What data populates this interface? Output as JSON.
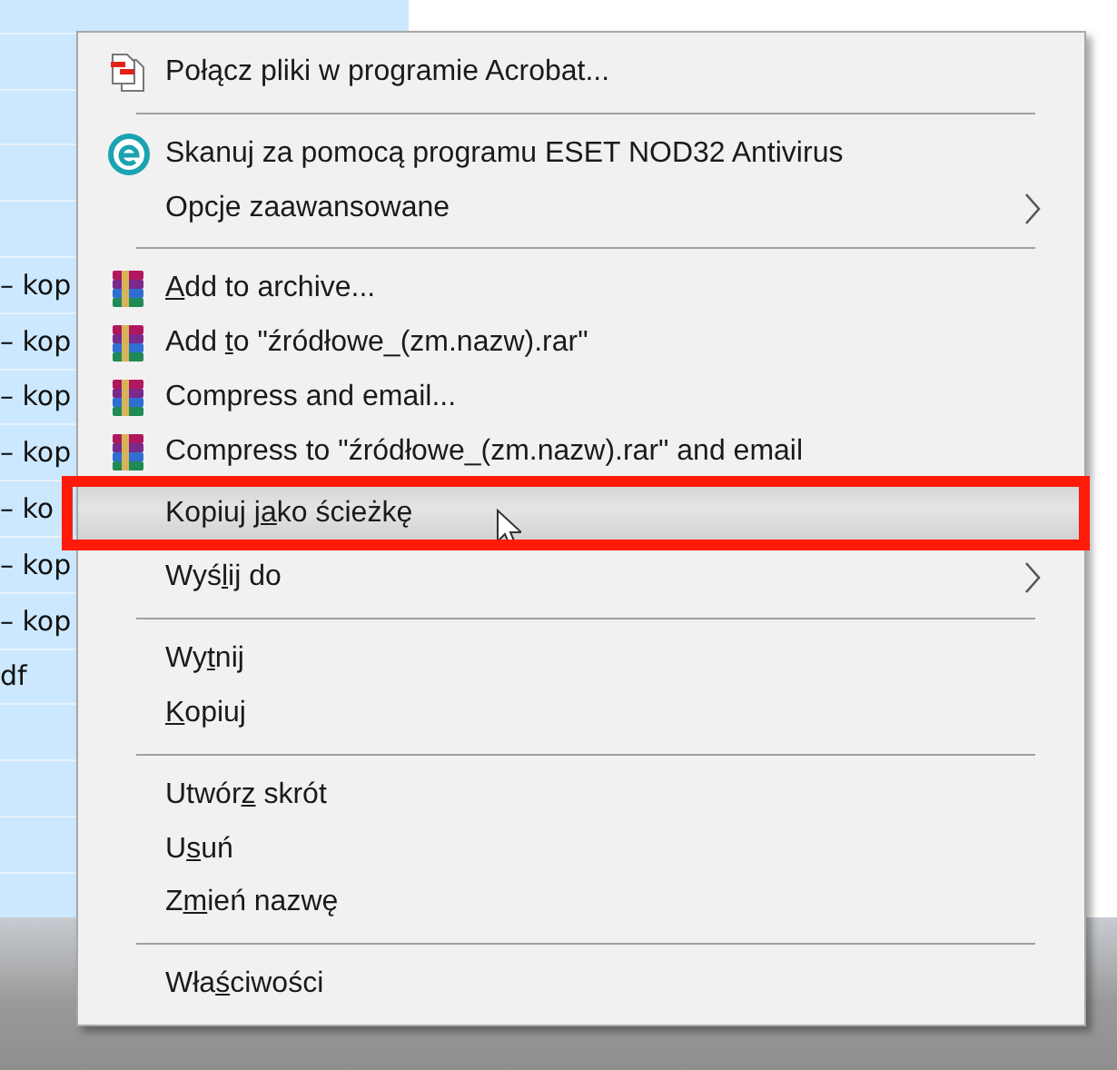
{
  "file_list": {
    "rows": [
      {},
      {},
      {},
      {},
      {},
      {
        "text": "– kop"
      },
      {
        "text": "– kop"
      },
      {
        "text": "– kop"
      },
      {
        "text": "– kop"
      },
      {
        "text": "– ko"
      },
      {
        "text": "– kop"
      },
      {
        "text": "– kop"
      },
      {
        "text": "df"
      },
      {},
      {},
      {},
      {}
    ]
  },
  "context_menu": {
    "items": [
      {
        "kind": "documents",
        "label": [
          {
            "text": "Połącz pliki w programie Acrobat...",
            "underlined": false
          }
        ],
        "submenu": false,
        "selected": false
      },
      {
        "kind": "separator"
      },
      {
        "kind": "antivirus",
        "label": [
          {
            "text": "Skanuj za pomocą programu ESET NOD32 Antivirus",
            "underlined": false
          }
        ],
        "submenu": false,
        "selected": false
      },
      {
        "kind": "plain",
        "label": [
          {
            "text": "Opcje zaawansowane",
            "underlined": false
          }
        ],
        "submenu": true,
        "selected": false
      },
      {
        "kind": "separator"
      },
      {
        "kind": "archive",
        "label": [
          {
            "text": "A",
            "underlined": true
          },
          {
            "text": "dd to archive...",
            "underlined": false
          }
        ],
        "submenu": false,
        "selected": false
      },
      {
        "kind": "archive",
        "label": [
          {
            "text": "Add ",
            "underlined": false
          },
          {
            "text": "t",
            "underlined": true
          },
          {
            "text": "o \"źródłowe_(zm.nazw).rar\"",
            "underlined": false
          }
        ],
        "submenu": false,
        "selected": false
      },
      {
        "kind": "archive",
        "label": [
          {
            "text": "Compress and email...",
            "underlined": false
          }
        ],
        "submenu": false,
        "selected": false
      },
      {
        "kind": "archive",
        "label": [
          {
            "text": "Compress to \"źródłowe_(zm.nazw).rar\" and email",
            "underlined": false
          }
        ],
        "submenu": false,
        "selected": false
      },
      {
        "kind": "plain",
        "label": [
          {
            "text": "Kopiuj j",
            "underlined": false
          },
          {
            "text": "a",
            "underlined": true
          },
          {
            "text": "ko ścieżkę",
            "underlined": false
          }
        ],
        "submenu": false,
        "selected": true,
        "annotated": true
      },
      {
        "kind": "plain",
        "label": [
          {
            "text": "Wyś",
            "underlined": false
          },
          {
            "text": "l",
            "underlined": true
          },
          {
            "text": "ij do",
            "underlined": false
          }
        ],
        "submenu": true,
        "selected": false
      },
      {
        "kind": "separator"
      },
      {
        "kind": "plain",
        "label": [
          {
            "text": "Wy",
            "underlined": false
          },
          {
            "text": "t",
            "underlined": true
          },
          {
            "text": "nij",
            "underlined": false
          }
        ],
        "submenu": false,
        "selected": false
      },
      {
        "kind": "plain",
        "label": [
          {
            "text": "K",
            "underlined": true
          },
          {
            "text": "opiuj",
            "underlined": false
          }
        ],
        "submenu": false,
        "selected": false
      },
      {
        "kind": "separator"
      },
      {
        "kind": "plain",
        "label": [
          {
            "text": "Utwór",
            "underlined": false
          },
          {
            "text": "z",
            "underlined": true
          },
          {
            "text": " skrót",
            "underlined": false
          }
        ],
        "submenu": false,
        "selected": false
      },
      {
        "kind": "plain",
        "label": [
          {
            "text": "U",
            "underlined": false
          },
          {
            "text": "s",
            "underlined": true
          },
          {
            "text": "uń",
            "underlined": false
          }
        ],
        "submenu": false,
        "selected": false
      },
      {
        "kind": "plain",
        "label": [
          {
            "text": "Z",
            "underlined": false
          },
          {
            "text": "m",
            "underlined": true
          },
          {
            "text": "ień nazwę",
            "underlined": false
          }
        ],
        "submenu": false,
        "selected": false
      },
      {
        "kind": "separator"
      },
      {
        "kind": "plain",
        "label": [
          {
            "text": "Wła",
            "underlined": false
          },
          {
            "text": "ś",
            "underlined": true
          },
          {
            "text": "ciwości",
            "underlined": false
          }
        ],
        "submenu": false,
        "selected": false
      }
    ]
  }
}
